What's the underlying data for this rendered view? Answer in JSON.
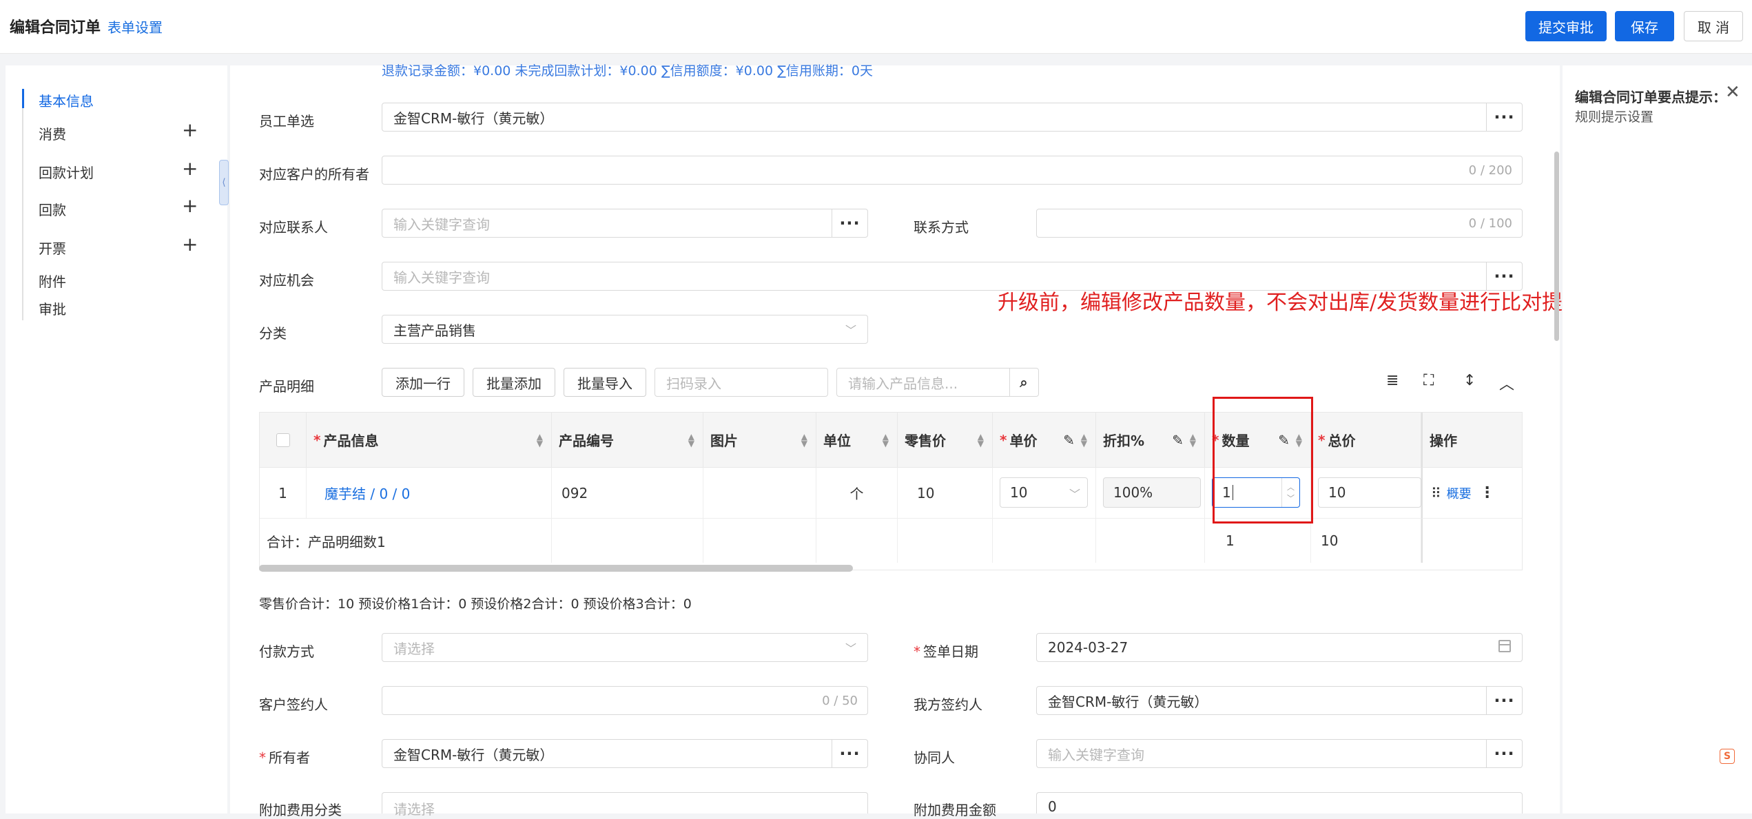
{
  "header": {
    "title": "编辑合同订单",
    "form_settings": "表单设置",
    "submit_label": "提交审批",
    "save_label": "保存",
    "cancel_label": "取 消"
  },
  "sidebar": {
    "items": [
      {
        "label": "基本信息",
        "active": true
      },
      {
        "label": "消费",
        "plus": true
      },
      {
        "label": "回款计划",
        "plus": true
      },
      {
        "label": "回款",
        "plus": true
      },
      {
        "label": "开票",
        "plus": true
      },
      {
        "label": "附件"
      },
      {
        "label": "审批"
      }
    ],
    "plus_glyph": "+"
  },
  "summary_line": "退款记录金额：¥0.00    未完成回款计划：¥0.00    ∑信用额度：¥0.00    ∑信用账期：0天",
  "form": {
    "employee_label": "员工单选",
    "employee_value": "金智CRM-敏行（黄元敏）",
    "owner_of_customer_label": "对应客户的所有者",
    "owner_of_customer_counter": "0 / 200",
    "contact_label": "对应联系人",
    "contact_placeholder": "输入关键字查询",
    "contact_method_label": "联系方式",
    "contact_method_counter": "0 / 100",
    "opportunity_label": "对应机会",
    "opportunity_placeholder": "输入关键字查询",
    "category_label": "分类",
    "category_value": "主营产品销售",
    "product_detail_label": "产品明细",
    "add_row": "添加一行",
    "batch_add": "批量添加",
    "batch_import": "批量导入",
    "scan_placeholder": "扫码录入",
    "product_search_placeholder": "请输入产品信息...",
    "totals_line": "零售价合计：10  预设价格1合计：0  预设价格2合计：0  预设价格3合计：0",
    "payment_label": "付款方式",
    "payment_placeholder": "请选择",
    "sign_date_label": "签单日期",
    "sign_date_value": "2024-03-27",
    "customer_signer_label": "客户签约人",
    "customer_signer_counter": "0 / 50",
    "our_signer_label": "我方签约人",
    "our_signer_value": "金智CRM-敏行（黄元敏）",
    "owner_label": "所有者",
    "owner_value": "金智CRM-敏行（黄元敏）",
    "collaborator_label": "协同人",
    "collaborator_placeholder": "输入关键字查询",
    "extra_fee_category_label": "附加费用分类",
    "extra_fee_category_placeholder": "请选择",
    "extra_fee_amount_label": "附加费用金额",
    "extra_fee_amount_value": "0",
    "required_mark": "*",
    "more_glyph": "···"
  },
  "table": {
    "headers": {
      "product": "产品信息",
      "code": "产品编号",
      "image": "图片",
      "unit": "单位",
      "retail": "零售价",
      "price": "单价",
      "discount": "折扣%",
      "qty": "数量",
      "total": "总价",
      "ops": "操作"
    },
    "row": {
      "index": "1",
      "product": "魔芋结 / 0 / 0",
      "code": "092",
      "unit": "个",
      "retail": "10",
      "price": "10",
      "discount": "100%",
      "qty": "1",
      "total": "10",
      "op_link": "概要"
    },
    "footer": {
      "label": "合计：产品明细数1",
      "qty": "1",
      "total": "10"
    }
  },
  "annotation": "升级前，编辑修改产品数量，不会对出库/发货数量进行比对提醒",
  "right_panel": {
    "title": "编辑合同订单要点提示：",
    "subtitle": "规则提示设置"
  },
  "colors": {
    "primary": "#1268e3",
    "annotation": "#e02020"
  }
}
